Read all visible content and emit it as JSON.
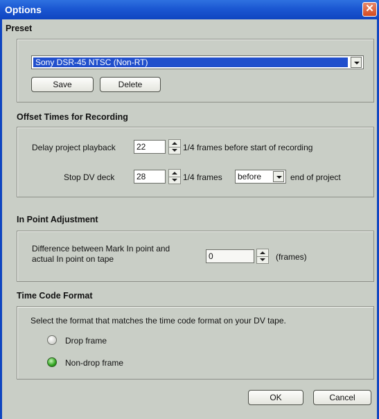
{
  "window": {
    "title": "Options"
  },
  "preset": {
    "section_title": "Preset",
    "selected": "Sony DSR-45 NTSC (Non-RT)",
    "save_label": "Save",
    "delete_label": "Delete"
  },
  "offset": {
    "section_title": "Offset Times for Recording",
    "delay_label": "Delay project playback",
    "delay_value": "22",
    "delay_suffix": "1/4 frames before start of recording",
    "stop_label": "Stop DV deck",
    "stop_value": "28",
    "stop_suffix": "1/4 frames",
    "stop_when": "before",
    "stop_end": "end of project"
  },
  "inpoint": {
    "section_title": "In Point Adjustment",
    "description_line1": "Difference between Mark In point and",
    "description_line2": "actual In point on tape",
    "value": "0",
    "unit": "(frames)"
  },
  "timecode": {
    "section_title": "Time Code Format",
    "instruction": "Select the format that matches the time code format on your DV tape.",
    "options": [
      {
        "label": "Drop frame",
        "checked": false
      },
      {
        "label": "Non-drop frame",
        "checked": true
      }
    ]
  },
  "footer": {
    "ok_label": "OK",
    "cancel_label": "Cancel"
  },
  "colors": {
    "titlebar": "#1b57d2",
    "dialog_bg": "#c9cec6",
    "selection": "#214fcc",
    "radio_checked": "#2fa31e"
  },
  "icons": {
    "close": "close-icon",
    "dropdown": "chevron-down-icon",
    "spinner": "spinner-arrows-icon"
  }
}
